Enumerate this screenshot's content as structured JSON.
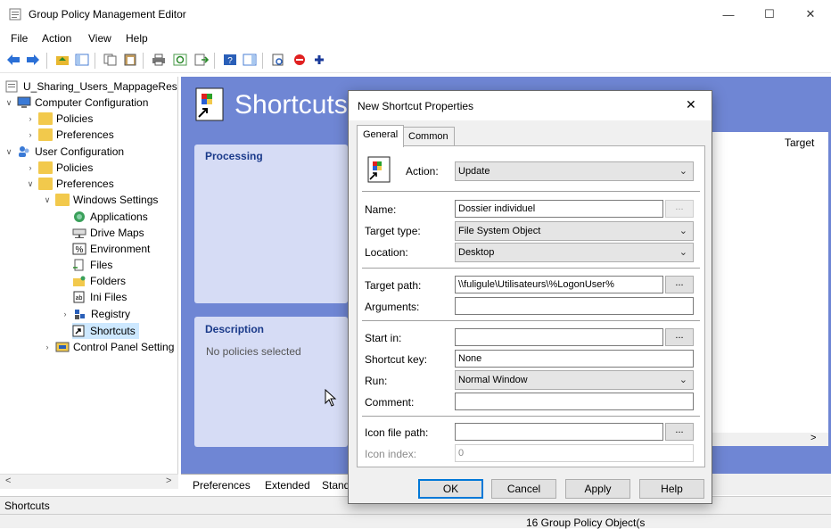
{
  "window": {
    "title": "Group Policy Management Editor"
  },
  "menu": [
    "File",
    "Action",
    "View",
    "Help"
  ],
  "tree": [
    {
      "label": "U_Sharing_Users_MappageRese",
      "icon": "gpo-icon"
    },
    {
      "label": "Computer Configuration",
      "icon": "computer-icon"
    },
    {
      "label": "Policies",
      "icon": "folder-icon"
    },
    {
      "label": "Preferences",
      "icon": "folder-icon"
    },
    {
      "label": "User Configuration",
      "icon": "user-icon"
    },
    {
      "label": "Policies",
      "icon": "folder-icon"
    },
    {
      "label": "Preferences",
      "icon": "folder-icon"
    },
    {
      "label": "Windows Settings",
      "icon": "folder-icon"
    },
    {
      "label": "Applications",
      "icon": "applications-icon"
    },
    {
      "label": "Drive Maps",
      "icon": "drive-maps-icon"
    },
    {
      "label": "Environment",
      "icon": "environment-icon"
    },
    {
      "label": "Files",
      "icon": "files-icon"
    },
    {
      "label": "Folders",
      "icon": "folders-icon"
    },
    {
      "label": "Ini Files",
      "icon": "ini-files-icon"
    },
    {
      "label": "Registry",
      "icon": "registry-icon"
    },
    {
      "label": "Shortcuts",
      "icon": "shortcuts-icon"
    },
    {
      "label": "Control Panel Setting",
      "icon": "control-panel-icon"
    }
  ],
  "main": {
    "title": "Shortcuts",
    "processing_header": "Processing",
    "description_header": "Description",
    "description_text": "No policies selected",
    "column_target": "Target"
  },
  "bottom_tabs": [
    "Preferences",
    "Extended",
    "Stand"
  ],
  "status": {
    "left": "Shortcuts",
    "right": "16 Group Policy Object(s"
  },
  "dialog": {
    "title": "New Shortcut Properties",
    "tabs": [
      "General",
      "Common"
    ],
    "action_label": "Action:",
    "action_value": "Update",
    "name_label": "Name:",
    "name_value": "Dossier individuel",
    "target_type_label": "Target type:",
    "target_type_value": "File System Object",
    "location_label": "Location:",
    "location_value": "Desktop",
    "target_path_label": "Target path:",
    "target_path_value": "\\\\fuligule\\Utilisateurs\\%LogonUser%",
    "arguments_label": "Arguments:",
    "arguments_value": "",
    "start_in_label": "Start in:",
    "start_in_value": "",
    "shortcut_key_label": "Shortcut key:",
    "shortcut_key_value": "None",
    "run_label": "Run:",
    "run_value": "Normal Window",
    "comment_label": "Comment:",
    "comment_value": "",
    "icon_file_label": "Icon file path:",
    "icon_file_value": "",
    "icon_index_label": "Icon index:",
    "icon_index_value": "0",
    "browse": "...",
    "buttons": {
      "ok": "OK",
      "cancel": "Cancel",
      "apply": "Apply",
      "help": "Help"
    }
  }
}
